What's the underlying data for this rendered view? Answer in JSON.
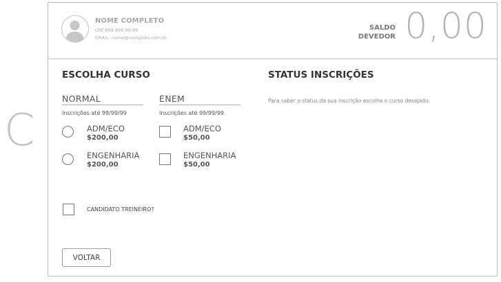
{
  "side_letter": "C",
  "user": {
    "name": "NOME COMPLETO",
    "cpf": "CPF 999.999.99-99",
    "email": "EMAIL: nome@completo.com.br"
  },
  "balance": {
    "label_line1": "SALDO",
    "label_line2": "DEVEDOR",
    "value": "0,00"
  },
  "course_section": {
    "title": "ESCOLHA CURSO",
    "columns": [
      {
        "name": "NORMAL",
        "date": "Inscrições até 99/99/99",
        "control": "radio",
        "options": [
          {
            "label": "ADM/ECO",
            "price": "$200,00"
          },
          {
            "label": "ENGENHARIA",
            "price": "$200,00"
          }
        ]
      },
      {
        "name": "ENEM",
        "date": "Inscrições até 99/99/99",
        "control": "checkbox",
        "options": [
          {
            "label": "ADM/ECO",
            "price": "$50,00"
          },
          {
            "label": "ENGENHARIA",
            "price": "$50,00"
          }
        ]
      }
    ],
    "trainee_label": "CANDIDATO TREINEIRO?"
  },
  "status_section": {
    "title": "STATUS INSCRIÇÕES",
    "description": "Para saber o status da sua inscrição escolhe o curso desejado."
  },
  "back_button": "VOLTAR"
}
